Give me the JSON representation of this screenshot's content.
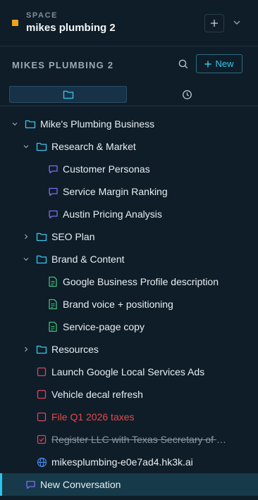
{
  "space": {
    "label": "SPACE",
    "name": "mikes plumbing 2"
  },
  "workspace": {
    "title": "MIKES PLUMBING 2",
    "new_label": "New"
  },
  "tree": [
    {
      "label": "Mike's Plumbing Business",
      "type": "folder",
      "expanded": true
    },
    {
      "label": "Research & Market",
      "type": "folder",
      "expanded": true
    },
    {
      "label": "Customer Personas",
      "type": "chat"
    },
    {
      "label": "Service Margin Ranking",
      "type": "chat"
    },
    {
      "label": "Austin Pricing Analysis",
      "type": "chat"
    },
    {
      "label": "SEO Plan",
      "type": "folder",
      "expanded": false
    },
    {
      "label": "Brand & Content",
      "type": "folder",
      "expanded": true
    },
    {
      "label": "Google Business Profile description",
      "type": "doc"
    },
    {
      "label": "Brand voice + positioning",
      "type": "doc"
    },
    {
      "label": "Service-page copy",
      "type": "doc"
    },
    {
      "label": "Resources",
      "type": "folder",
      "expanded": false
    },
    {
      "label": "Launch Google Local Services Ads",
      "type": "task"
    },
    {
      "label": "Vehicle decal refresh",
      "type": "task"
    },
    {
      "label": "File Q1 2026 taxes",
      "type": "task",
      "status": "overdue"
    },
    {
      "label": "Register LLC with Texas Secretary of State",
      "type": "task",
      "status": "done"
    },
    {
      "label": "mikesplumbing-e0e7ad4.hk3k.ai",
      "type": "site"
    },
    {
      "label": "New Conversation",
      "type": "chat",
      "active": true
    }
  ],
  "colors": {
    "accent": "#2cc6ec",
    "folder": "#36c8ee",
    "chat": "#7c6cf0",
    "doc": "#3fbf7a",
    "task": "#d8465a",
    "space": "#f0a21c"
  }
}
